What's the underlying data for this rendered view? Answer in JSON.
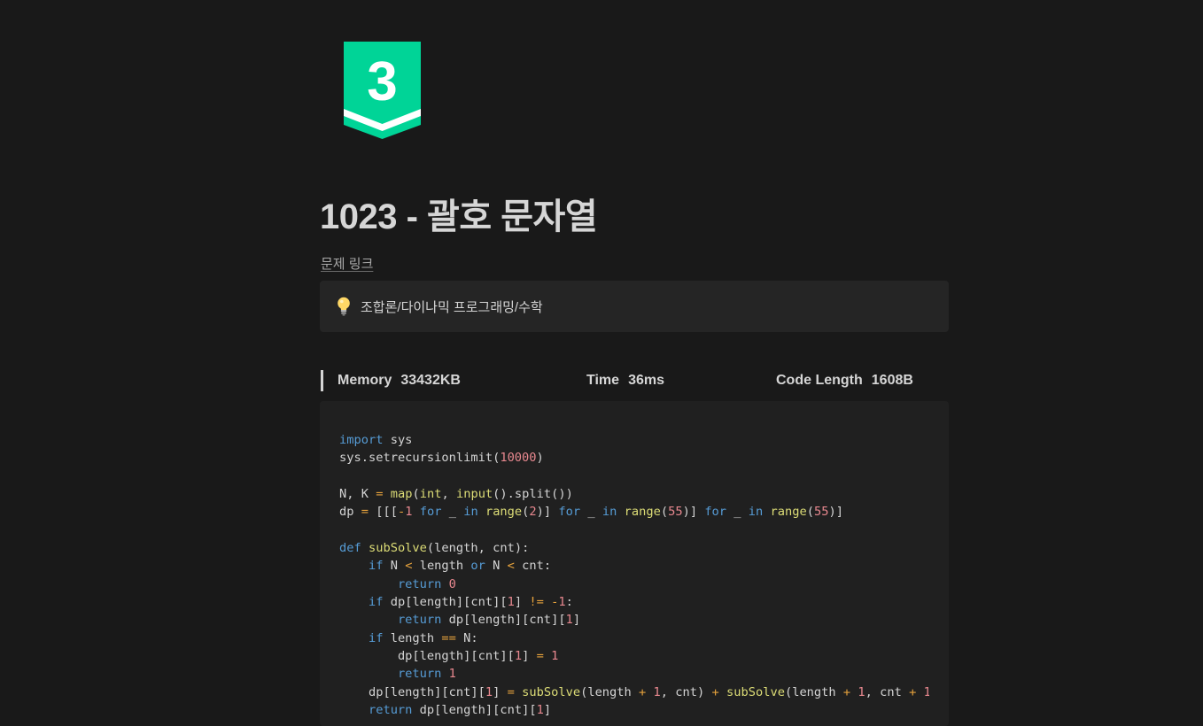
{
  "badge": {
    "number": "3",
    "color": "#00d497",
    "icon": "level-badge-icon"
  },
  "title": "1023 - 괄호 문자열",
  "link_text": "문제 링크",
  "callout": {
    "icon": "lightbulb-icon",
    "text": "조합론/다이나믹 프로그래밍/수학"
  },
  "stats": {
    "memory_label": "Memory",
    "memory_value": "33432KB",
    "time_label": "Time",
    "time_value": "36ms",
    "length_label": "Code Length",
    "length_value": "1608B"
  },
  "code": {
    "language": "python",
    "lines": [
      "import sys",
      "sys.setrecursionlimit(10000)",
      "",
      "N, K = map(int, input().split())",
      "dp = [[[-1 for _ in range(2)] for _ in range(55)] for _ in range(55)]",
      "",
      "def subSolve(length, cnt):",
      "    if N < length or N < cnt:",
      "        return 0",
      "    if dp[length][cnt][1] != -1:",
      "        return dp[length][cnt][1]",
      "    if length == N:",
      "        dp[length][cnt][1] = 1",
      "        return 1",
      "    dp[length][cnt][1] = subSolve(length + 1, cnt) + subSolve(length + 1, cnt + 1",
      "    return dp[length][cnt][1]"
    ]
  },
  "colors": {
    "background": "#191919",
    "callout_bg": "#252525",
    "code_bg": "#202020",
    "keyword": "#569cd6",
    "function": "#dcdc76",
    "number": "#e8888f",
    "operator": "#e6a23c"
  }
}
